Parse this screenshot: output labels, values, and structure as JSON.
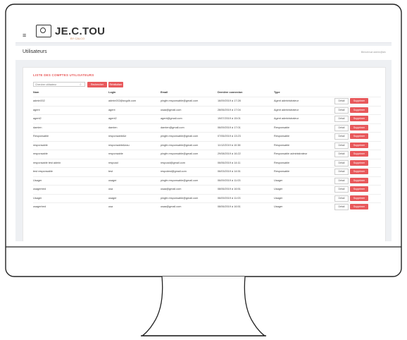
{
  "app": {
    "logo_title": "JE.C.TOU",
    "logo_subtitle": "BY CALCO"
  },
  "page": {
    "title": "Utilisateurs",
    "breadcrumb": "Bienvenue admin@sfc",
    "card_title": "LISTE DES COMPTES UTILISATEURS"
  },
  "search": {
    "placeholder": "Chercher utilisateur",
    "search_label": "Rechercher",
    "reset_label": "Réinitialiser"
  },
  "table": {
    "headers": [
      "Nom",
      "Login",
      "Email",
      "Dernière connexion",
      "Type"
    ],
    "rows": [
      {
        "nom": "admin002",
        "login": "admin002@sngdb.com",
        "email": "pingfe.responsable@gmail.com",
        "last": "16/09/2019 à 17:28",
        "type": "Agent administrateur"
      },
      {
        "nom": "agent",
        "login": "agent",
        "email": "usaa@gmail.com",
        "last": "28/06/2019 à 17:04",
        "type": "Agent administrateur"
      },
      {
        "nom": "agent2",
        "login": "agent2",
        "email": "agent@gmail.com",
        "last": "19/07/2019 à 15:01",
        "type": "Agent administrateur"
      },
      {
        "nom": "damien",
        "login": "damien",
        "email": "damien@gmail.com",
        "last": "06/09/2019 à 17:01",
        "type": "Responsable"
      },
      {
        "nom": "Responsable",
        "login": "responsable&e",
        "email": "pingfe.responsable@gmail.com",
        "last": "07/06/2019 à 13:23",
        "type": "Responsable"
      },
      {
        "nom": "responsable",
        "login": "responsable&eau",
        "email": "pingfe.responsable@gmail.com",
        "last": "11/12/2019 à 10:38",
        "type": "Responsable"
      },
      {
        "nom": "responsable",
        "login": "responsable",
        "email": "pingfe.responsable@gmail.com",
        "last": "29/08/2019 à 16:22",
        "type": "Responsable administrateur"
      },
      {
        "nom": "responsable test admin",
        "login": "respoad",
        "email": "respoad@gmail.com",
        "last": "06/06/2019 à 14:11",
        "type": "Responsable"
      },
      {
        "nom": "test responsable",
        "login": "test",
        "email": "respotest@gmail.com",
        "last": "06/03/2019 à 14:51",
        "type": "Responsable"
      },
      {
        "nom": "Usager",
        "login": "usager",
        "email": "pingfe.responsable@gmail.com",
        "last": "06/09/2019 à 11:03",
        "type": "Usager"
      },
      {
        "nom": "usagerbed",
        "login": "usa",
        "email": "usaa@gmail.com",
        "last": "08/06/2019 à 16:51",
        "type": "Usager"
      },
      {
        "nom": "Usager",
        "login": "usager",
        "email": "pingfe.responsable@gmail.com",
        "last": "06/09/2019 à 11:03",
        "type": "Usager"
      },
      {
        "nom": "usagerbed",
        "login": "usa",
        "email": "usaa@gmail.com",
        "last": "08/06/2019 à 16:51",
        "type": "Usager"
      }
    ],
    "detail_label": "Détail",
    "delete_label": "Supprimer"
  },
  "colors": {
    "accent": "#e8595c",
    "background": "#eef0f3"
  }
}
